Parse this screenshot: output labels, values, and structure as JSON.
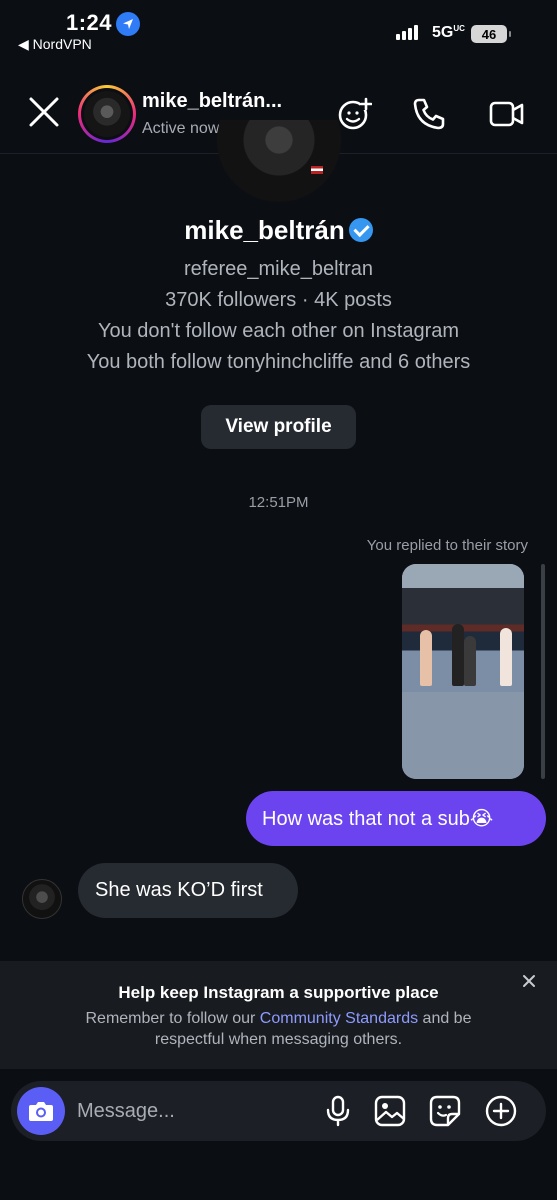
{
  "status_bar": {
    "time": "1:24",
    "back_app": "◀ NordVPN",
    "network": "5G",
    "network_sub": "UC",
    "battery": "46"
  },
  "header": {
    "username": "mike_beltrán...",
    "status": "Active now"
  },
  "profile": {
    "name": "mike_beltrán",
    "handle": "referee_mike_beltran",
    "stats": "370K followers · 4K posts",
    "follow_note": "You don't follow each other on Instagram",
    "mutuals": "You both follow tonyhinchcliffe and 6 others",
    "view_profile_label": "View profile"
  },
  "conversation": {
    "timestamp": "12:51PM",
    "story_reply_label": "You replied to their story",
    "sent_message": "How was that not a sub😭",
    "received_message": "She was KO’D first"
  },
  "banner": {
    "title": "Help keep Instagram a supportive place",
    "text_before": "Remember to follow our ",
    "link": "Community Standards",
    "text_after": " and be respectful when messaging others."
  },
  "composer": {
    "placeholder": "Message..."
  },
  "colors": {
    "background": "#0b0e13",
    "sent_bubble": "#6b44ef",
    "received_bubble": "#262a31",
    "camera_button": "#5b5ef5",
    "verified": "#3797f0",
    "link": "#8d9bff"
  },
  "icons": [
    "location-arrow-icon",
    "signal-icon",
    "battery-icon",
    "close-icon",
    "add-user-icon",
    "phone-icon",
    "video-icon",
    "verified-badge-icon",
    "camera-icon",
    "microphone-icon",
    "gallery-icon",
    "sticker-icon",
    "plus-circle-icon",
    "banner-close-icon"
  ]
}
